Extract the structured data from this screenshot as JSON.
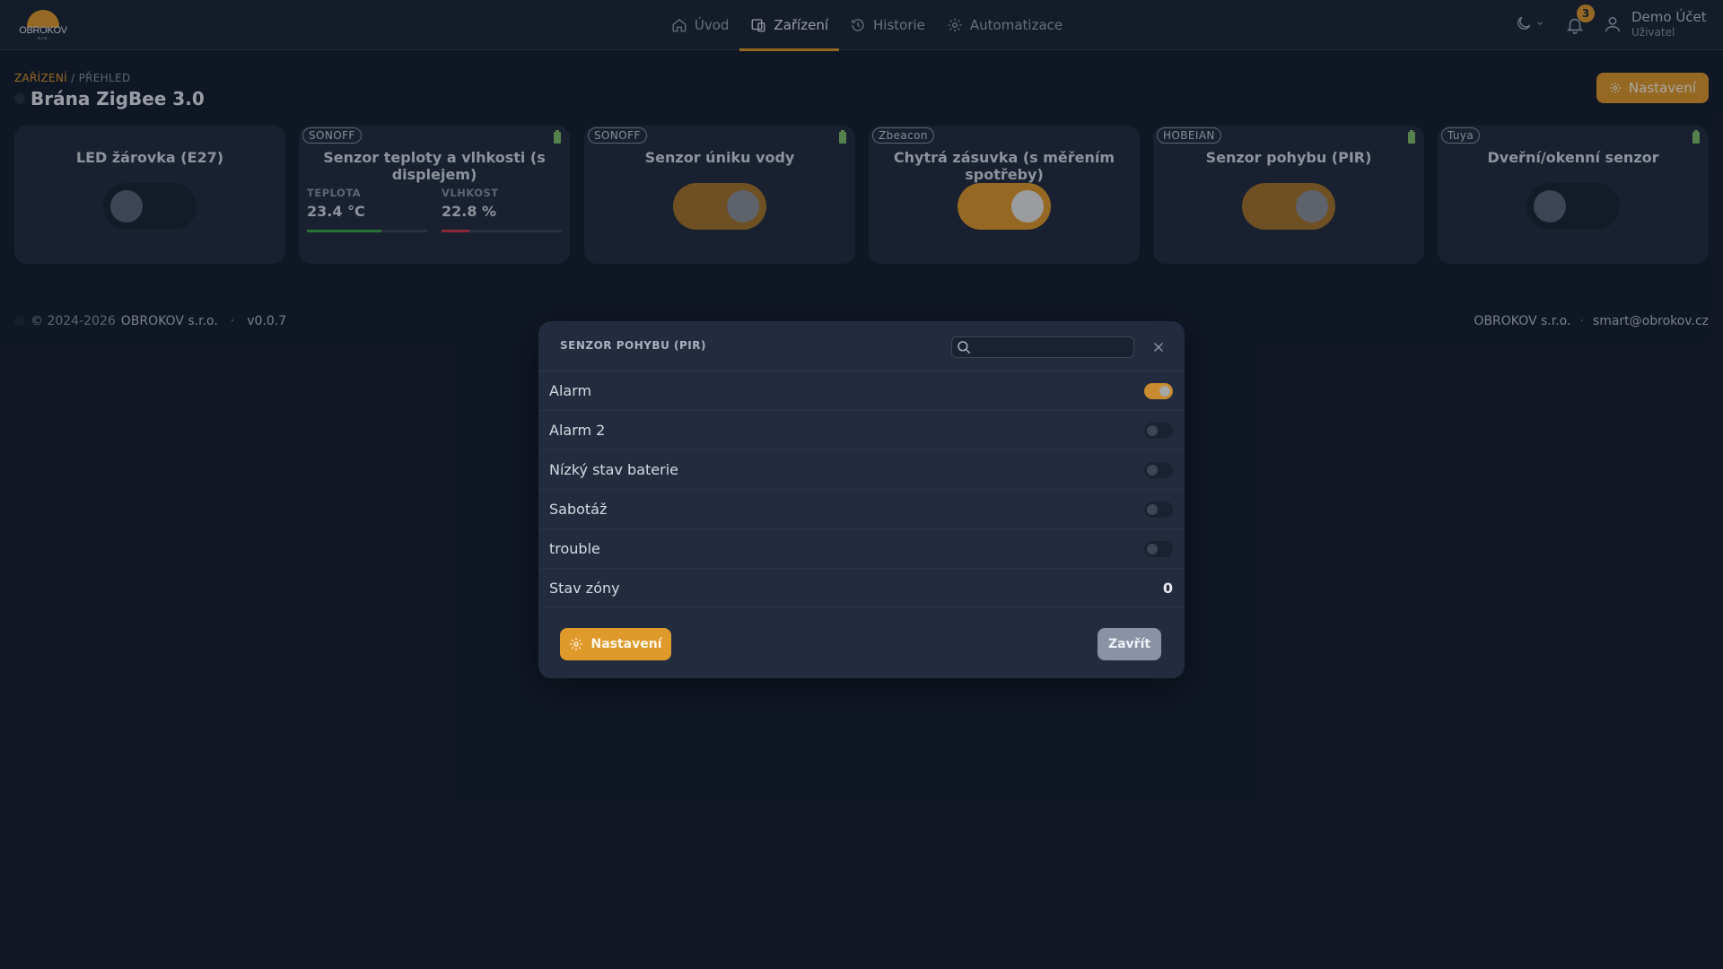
{
  "brand": {
    "logo_text": "OBROKOV",
    "logo_sub": "s.r.o."
  },
  "nav": [
    {
      "label": "Úvod",
      "icon": "home-icon",
      "active": false
    },
    {
      "label": "Zařízení",
      "icon": "devices-icon",
      "active": true
    },
    {
      "label": "Historie",
      "icon": "history-icon",
      "active": false
    },
    {
      "label": "Automatizace",
      "icon": "automation-gear-icon",
      "active": false
    }
  ],
  "notifications": {
    "count": "3"
  },
  "user": {
    "name": "Demo Účet",
    "role": "Uživatel"
  },
  "breadcrumb": {
    "first": "ZAŘÍZENÍ",
    "sep": " / ",
    "second": "PŘEHLED"
  },
  "page_title": "Brána ZigBee 3.0",
  "settings_label": "Nastavení",
  "cards": [
    {
      "title": "LED žárovka (E27)",
      "brand": "",
      "battery": false,
      "state": "off"
    },
    {
      "title": "Senzor teploty a vlhkosti (s displejem)",
      "brand": "SONOFF",
      "battery": true,
      "metrics": [
        {
          "label": "TEPLOTA",
          "value": "23.4 °C",
          "level": 0.62,
          "color": "#3aa84a"
        },
        {
          "label": "VLHKOST",
          "value": "22.8 %",
          "level": 0.23,
          "color": "#d23a48"
        }
      ]
    },
    {
      "title": "Senzor úniku vody",
      "brand": "SONOFF",
      "battery": true,
      "state": "on-dim"
    },
    {
      "title": "Chytrá zásuvka (s měřením spotřeby)",
      "brand": "Zbeacon",
      "battery": false,
      "state": "on"
    },
    {
      "title": "Senzor pohybu (PIR)",
      "brand": "HOBEIAN",
      "battery": true,
      "state": "on-dim"
    },
    {
      "title": "Dveřní/okenní senzor",
      "brand": "Tuya",
      "battery": true,
      "state": "off"
    }
  ],
  "footer": {
    "copyright": "© 2024-2026",
    "company": "OBROKOV s.r.o.",
    "dot": "·",
    "version": "v0.0.7",
    "right_company": "OBROKOV s.r.o.",
    "email": "smart@obrokov.cz"
  },
  "modal": {
    "title": "SENZOR POHYBU (PIR)",
    "search_placeholder": "",
    "rows": [
      {
        "label": "Alarm",
        "type": "toggle",
        "on": true
      },
      {
        "label": "Alarm 2",
        "type": "toggle",
        "on": false
      },
      {
        "label": "Nízký stav baterie",
        "type": "toggle",
        "on": false
      },
      {
        "label": "Sabotáž",
        "type": "toggle",
        "on": false
      },
      {
        "label": "trouble",
        "type": "toggle",
        "on": false
      },
      {
        "label": "Stav zóny",
        "type": "value",
        "value": "0"
      }
    ],
    "settings_label": "Nastavení",
    "close_label": "Zavřít"
  },
  "colors": {
    "accent": "#e09a2c",
    "background": "#141c2c",
    "card": "#222c3e"
  }
}
